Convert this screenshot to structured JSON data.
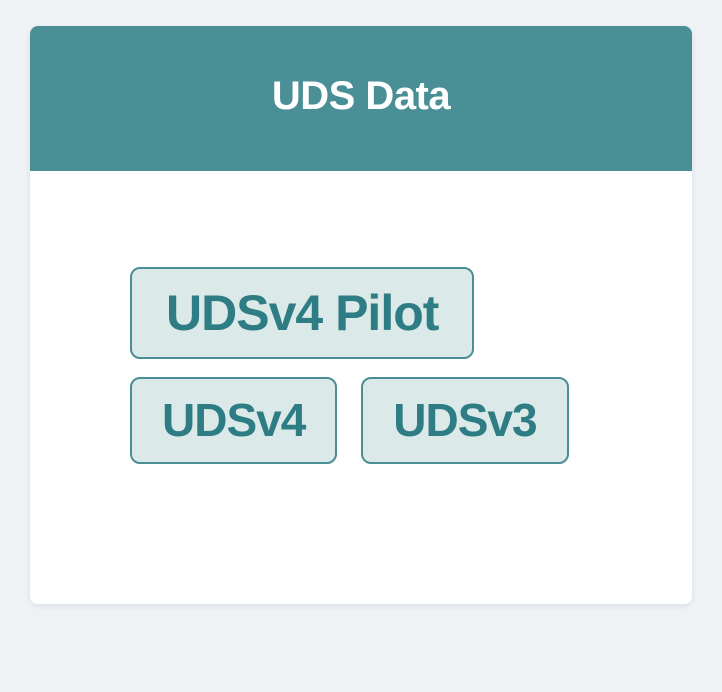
{
  "card": {
    "title": "UDS Data",
    "buttons": {
      "pilot": "UDSv4 Pilot",
      "v4": "UDSv4",
      "v3": "UDSv3"
    }
  }
}
